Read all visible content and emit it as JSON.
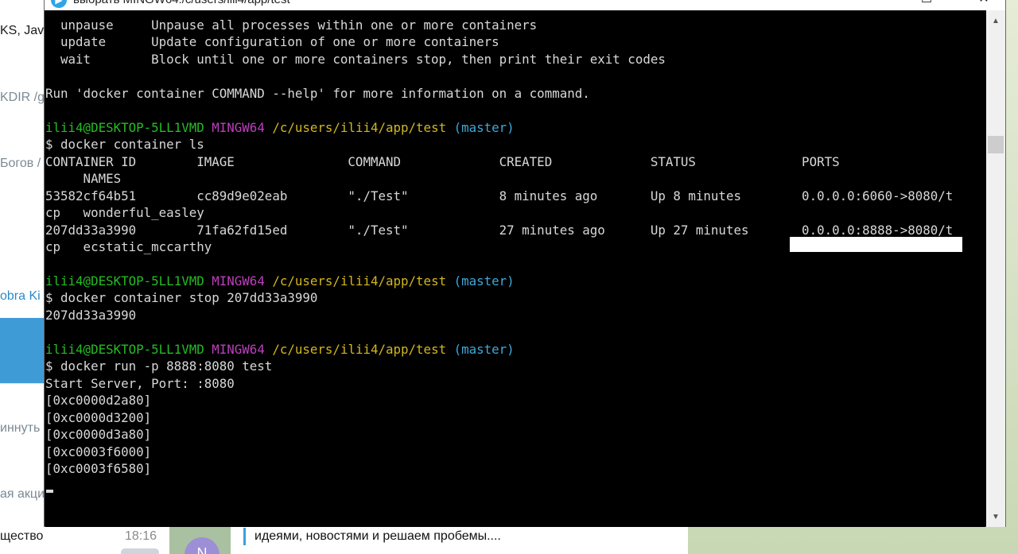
{
  "background_app": {
    "left_fragments": [
      "KS, Java",
      "KDIR /g",
      "Богов /",
      "obra Ki",
      "иннуть C",
      "ая акци",
      "щество"
    ],
    "chat_time": "18:16",
    "avatar_letter": "N",
    "message_preview": "идеями, новостями и решаем пробемы...."
  },
  "window": {
    "title": "выбрать MINGW64:/c/users/ilii4/app/test",
    "maximize_glyph": "☐",
    "close_glyph": "✕"
  },
  "terminal": {
    "l1": "  unpause     Unpause all processes within one or more containers",
    "l2": "  update      Update configuration of one or more containers",
    "l3": "  wait        Block until one or more containers stop, then print their exit codes",
    "l4": "Run 'docker container COMMAND --help' for more information on a command.",
    "prompt_user": "ilii4@DESKTOP-5LL1VMD",
    "prompt_env": "MINGW64",
    "prompt_path": "/c/users/ilii4/app/test",
    "prompt_branch": "(master)",
    "cmd1": "$ docker container ls",
    "hdr1": "CONTAINER ID        IMAGE               COMMAND             CREATED             STATUS              PORTS",
    "hdr2": "     NAMES",
    "row1a": "53582cf64b51        cc89d9e02eab        \"./Test\"            8 minutes ago       Up 8 minutes        0.0.0.0:6060->8080/t",
    "row1b": "cp   wonderful_easley",
    "row2a": "207dd33a3990        71fa62fd15ed        \"./Test\"            27 minutes ago      Up 27 minutes       0.0.0.0:8888->8080/t",
    "row2b": "cp   ecstatic_mccarthy",
    "cmd2": "$ docker container stop 207dd33a3990",
    "out2": "207dd33a3990",
    "cmd3": "$ docker run -p 8888:8080 test",
    "out3": "Start Server, Port: :8080",
    "addrs": [
      "[0xc0000d2a80]",
      "[0xc0000d3200]",
      "[0xc0000d3a80]",
      "[0xc0003f6000]",
      "[0xc0003f6580]"
    ]
  },
  "scrollbar": {
    "up_glyph": "▲",
    "down_glyph": "▼"
  }
}
